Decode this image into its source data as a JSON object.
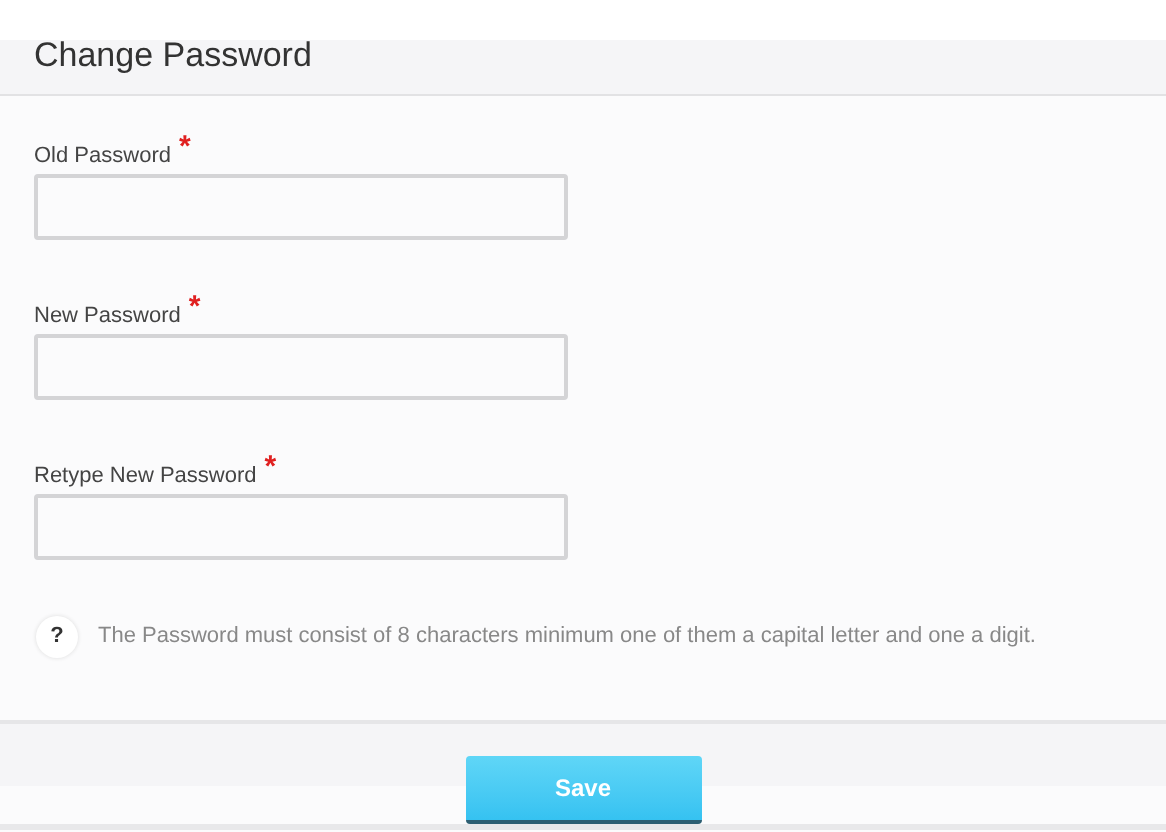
{
  "title": "Change Password",
  "fields": [
    {
      "label": "Old Password",
      "required_mark": "*"
    },
    {
      "label": "New Password",
      "required_mark": "*"
    },
    {
      "label": "Retype New Password",
      "required_mark": "*"
    }
  ],
  "hint": {
    "icon": "?",
    "text": "The Password must consist of 8 characters minimum one of them a capital letter and one a digit."
  },
  "buttons": [
    "Save"
  ]
}
